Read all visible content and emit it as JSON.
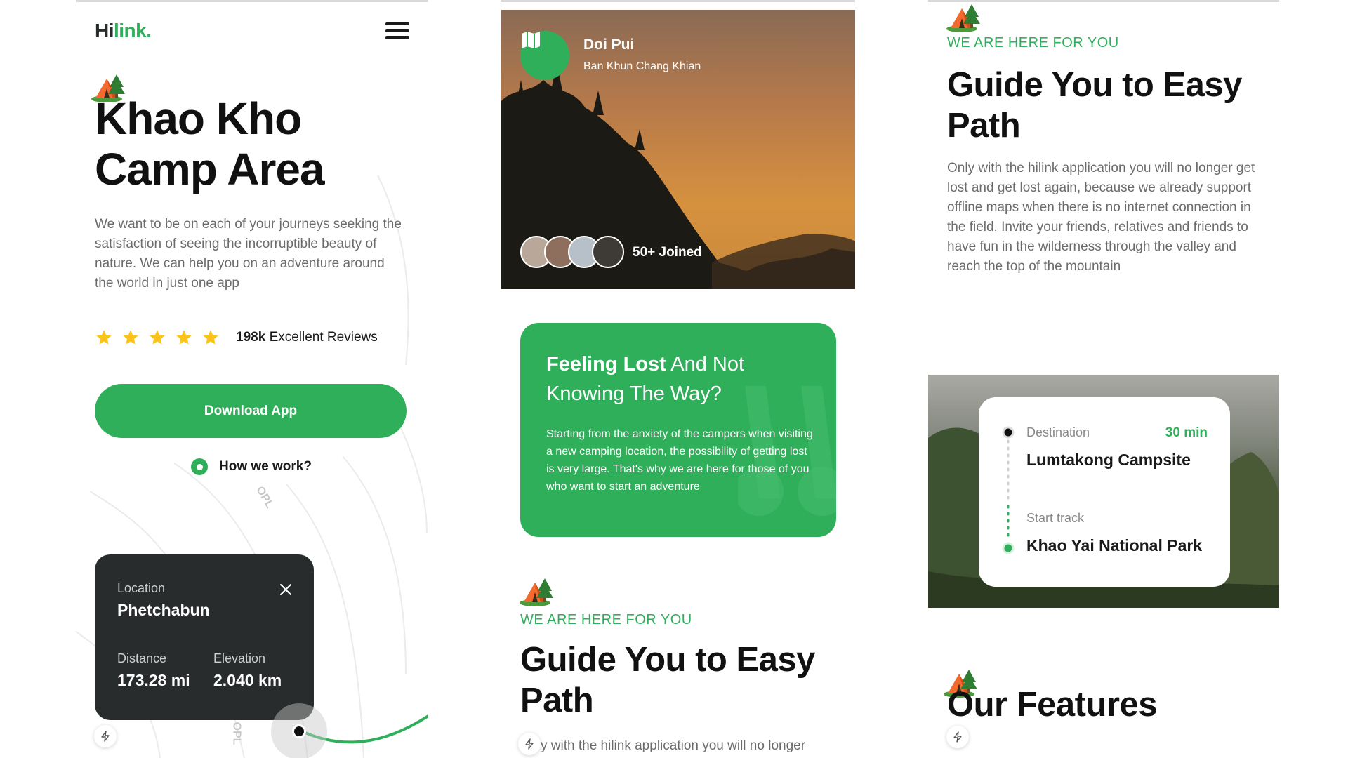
{
  "colors": {
    "brand_green": "#30af5b",
    "dark": "#292c2d",
    "gray_text": "#6b6b6b",
    "star": "#fcc41a"
  },
  "screen1": {
    "logo": {
      "part1": "Hi",
      "part2": "link."
    },
    "menu_icon": "hamburger-icon",
    "title_line1": "Khao Kho",
    "title_line2": "Camp Area",
    "description": "We want to be on each of your journeys seeking the satisfaction of seeing the incorruptible beauty of nature. We can help you on an adventure around the world in just one app",
    "rating": {
      "stars": 5,
      "count": "198k",
      "label": "Excellent Reviews"
    },
    "download_button": "Download App",
    "how_link": "How we work?",
    "map_label": "OPL",
    "map_label2": "OPL",
    "location_card": {
      "location_label": "Location",
      "location_value": "Phetchabun",
      "distance_label": "Distance",
      "distance_value": "173.28 mi",
      "elevation_label": "Elevation",
      "elevation_value": "2.040 km"
    }
  },
  "screen2": {
    "hero": {
      "place_name": "Doi Pui",
      "place_sub": "Ban Khun Chang Khian",
      "joined": "50+ Joined"
    },
    "card": {
      "title_bold": "Feeling Lost",
      "title_rest": " And Not Knowing The Way?",
      "description": "Starting from the anxiety of the campers when visiting a new camping location, the possibility of getting lost is very large. That's why we are here for those of you who want to start an adventure"
    },
    "eyebrow": "WE ARE HERE FOR YOU",
    "heading": "Guide You to Easy Path",
    "paragraph_fragment": "y with the hilink application you will no longer"
  },
  "screen3": {
    "eyebrow": "WE ARE HERE FOR YOU",
    "heading": "Guide You to Easy Path",
    "paragraph": "Only with the hilink application you will no longer get lost and get lost again, because we already support offline maps when there is no internet connection in the field. Invite your friends, relatives and friends to have fun in the wilderness through the valley and reach the top of the mountain",
    "route_card": {
      "destination_label": "Destination",
      "time": "30 min",
      "destination_value": "Lumtakong Campsite",
      "start_label": "Start track",
      "start_value": "Khao Yai National Park"
    },
    "features_heading": "Our Features"
  }
}
